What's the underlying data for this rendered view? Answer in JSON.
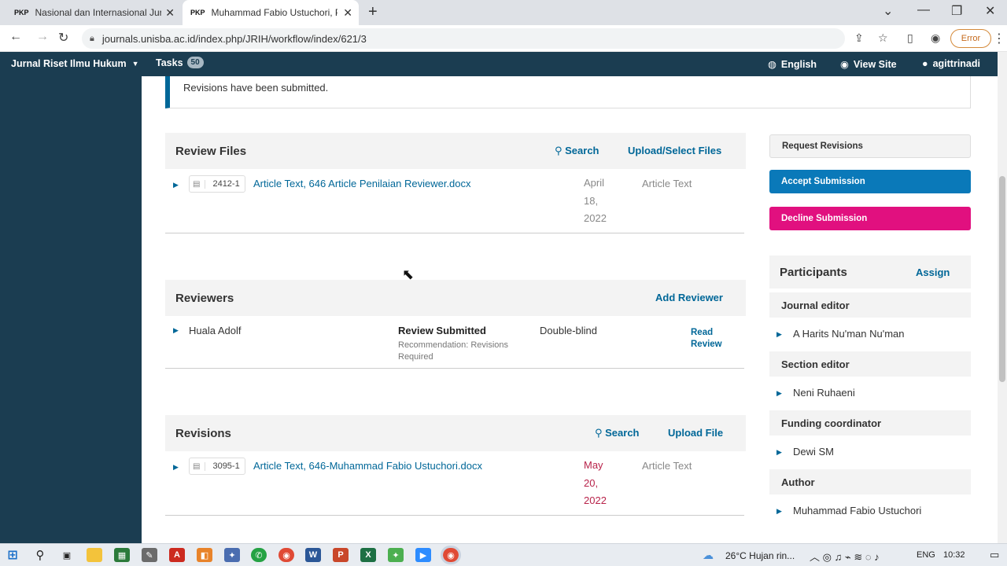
{
  "browser": {
    "tabs": [
      {
        "favicon": "PKP",
        "title": "Nasional dan Internasional Jurnal"
      },
      {
        "favicon": "PKP",
        "title": "Muhammad Fabio Ustuchori, Per"
      }
    ],
    "url": "journals.unisba.ac.id/index.php/JRIH/workflow/index/621/3",
    "error_label": "Error"
  },
  "header": {
    "journal": "Jurnal Riset Ilmu Hukum",
    "tasks_label": "Tasks",
    "tasks_count": "50",
    "language": "English",
    "view_site": "View Site",
    "user": "agittrinadi"
  },
  "notice": "Revisions have been submitted.",
  "review_files": {
    "title": "Review Files",
    "search": "Search",
    "upload": "Upload/Select Files",
    "file": {
      "id": "2412-1",
      "name": "Article Text, 646 Article Penilaian Reviewer.docx",
      "date": [
        "April",
        "18,",
        "2022"
      ],
      "type": "Article Text"
    }
  },
  "reviewers": {
    "title": "Reviewers",
    "add": "Add Reviewer",
    "row": {
      "name": "Huala Adolf",
      "status": "Review Submitted",
      "recommendation": "Recommendation: Revisions Required",
      "method": "Double-blind",
      "action_line1": "Read",
      "action_line2": "Review"
    }
  },
  "revisions": {
    "title": "Revisions",
    "search": "Search",
    "upload": "Upload File",
    "file": {
      "id": "3095-1",
      "name": "Article Text, 646-Muhammad Fabio Ustuchori.docx",
      "date": [
        "May",
        "20,",
        "2022"
      ],
      "type": "Article Text"
    }
  },
  "actions": {
    "request": "Request Revisions",
    "accept": "Accept Submission",
    "decline": "Decline Submission"
  },
  "participants": {
    "title": "Participants",
    "assign": "Assign",
    "groups": [
      {
        "role": "Journal editor",
        "name": "A Harits Nu'man Nu'man"
      },
      {
        "role": "Section editor",
        "name": "Neni Ruhaeni"
      },
      {
        "role": "Funding coordinator",
        "name": "Dewi SM"
      },
      {
        "role": "Author",
        "name": "Muhammad Fabio Ustuchori"
      }
    ]
  },
  "taskbar": {
    "weather": "26°C  Hujan rin...",
    "lang": "ENG",
    "time": "10:32"
  }
}
